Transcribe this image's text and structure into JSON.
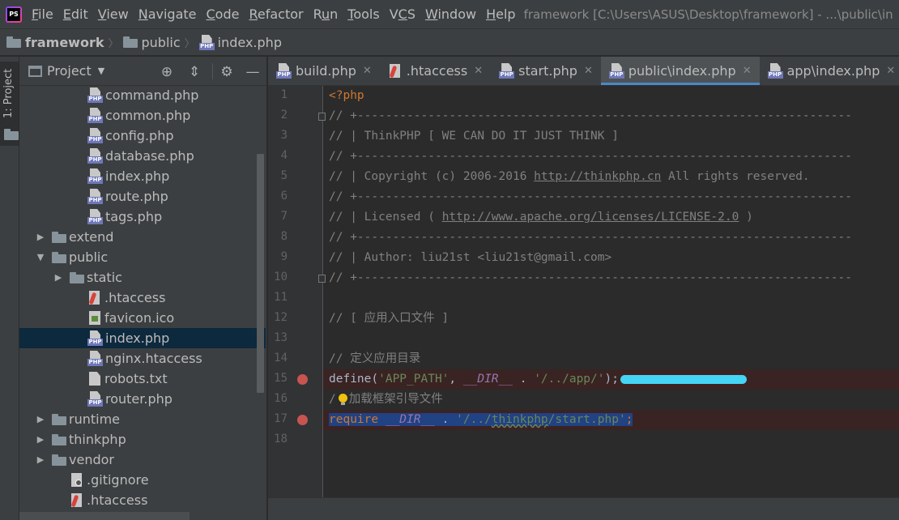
{
  "menu": {
    "items": [
      "File",
      "Edit",
      "View",
      "Navigate",
      "Code",
      "Refactor",
      "Run",
      "Tools",
      "VCS",
      "Window",
      "Help"
    ],
    "underline_index": [
      0,
      0,
      0,
      0,
      0,
      0,
      1,
      0,
      1,
      0,
      0
    ],
    "window_title": "framework [C:\\Users\\ASUS\\Desktop\\framework] - ...\\public\\in",
    "logo_text": "PS"
  },
  "breadcrumb": {
    "items": [
      "framework",
      "public",
      "index.php"
    ]
  },
  "toolstrip": {
    "project_label": "1: Project"
  },
  "project": {
    "title": "Project",
    "tree": [
      {
        "label": "command.php",
        "icon": "php-file-icon",
        "indent": 3,
        "toggle": ""
      },
      {
        "label": "common.php",
        "icon": "php-file-icon",
        "indent": 3,
        "toggle": ""
      },
      {
        "label": "config.php",
        "icon": "php-file-icon",
        "indent": 3,
        "toggle": ""
      },
      {
        "label": "database.php",
        "icon": "php-file-icon",
        "indent": 3,
        "toggle": ""
      },
      {
        "label": "index.php",
        "icon": "php-file-icon",
        "indent": 3,
        "toggle": ""
      },
      {
        "label": "route.php",
        "icon": "php-file-icon",
        "indent": 3,
        "toggle": ""
      },
      {
        "label": "tags.php",
        "icon": "php-file-icon",
        "indent": 3,
        "toggle": ""
      },
      {
        "label": "extend",
        "icon": "folder-icon",
        "indent": 1,
        "toggle": "▶"
      },
      {
        "label": "public",
        "icon": "folder-icon",
        "indent": 1,
        "toggle": "▼"
      },
      {
        "label": "static",
        "icon": "folder-icon",
        "indent": 2,
        "toggle": "▶"
      },
      {
        "label": ".htaccess",
        "icon": "htaccess-file-icon",
        "indent": 3,
        "toggle": ""
      },
      {
        "label": "favicon.ico",
        "icon": "image-file-icon",
        "indent": 3,
        "toggle": ""
      },
      {
        "label": "index.php",
        "icon": "php-file-icon",
        "indent": 3,
        "toggle": "",
        "selected": true
      },
      {
        "label": "nginx.htaccess",
        "icon": "php-file-icon",
        "indent": 3,
        "toggle": ""
      },
      {
        "label": "robots.txt",
        "icon": "text-file-icon",
        "indent": 3,
        "toggle": ""
      },
      {
        "label": "router.php",
        "icon": "php-file-icon",
        "indent": 3,
        "toggle": ""
      },
      {
        "label": "runtime",
        "icon": "folder-icon",
        "indent": 1,
        "toggle": "▶"
      },
      {
        "label": "thinkphp",
        "icon": "folder-icon",
        "indent": 1,
        "toggle": "▶"
      },
      {
        "label": "vendor",
        "icon": "folder-icon",
        "indent": 1,
        "toggle": "▶"
      },
      {
        "label": ".gitignore",
        "icon": "gitignore-file-icon",
        "indent": 2,
        "toggle": ""
      },
      {
        "label": ".htaccess",
        "icon": "htaccess-file-icon",
        "indent": 2,
        "toggle": ""
      }
    ]
  },
  "tabs": [
    {
      "label": "build.php",
      "icon": "php-file-icon",
      "active": false
    },
    {
      "label": ".htaccess",
      "icon": "htaccess-file-icon",
      "active": false
    },
    {
      "label": "start.php",
      "icon": "php-file-icon",
      "active": false
    },
    {
      "label": "public\\index.php",
      "icon": "php-file-icon",
      "active": true
    },
    {
      "label": "app\\index.php",
      "icon": "php-file-icon",
      "active": false
    },
    {
      "label": "",
      "icon": "php-file-icon",
      "active": false
    }
  ],
  "editor": {
    "line_numbers": [
      "1",
      "2",
      "3",
      "4",
      "5",
      "6",
      "7",
      "8",
      "9",
      "10",
      "11",
      "12",
      "13",
      "14",
      "15",
      "16",
      "17",
      "18"
    ],
    "breakpoints": [
      15,
      17
    ],
    "fold_markers": [
      2,
      10
    ],
    "code": {
      "l1": "<?php",
      "l2": "// +----------------------------------------------------------------------",
      "l3": "// | ThinkPHP [ WE CAN DO IT JUST THINK ]",
      "l4": "// +----------------------------------------------------------------------",
      "l5_pre": "// | Copyright (c) 2006-2016 ",
      "l5_link": "http://thinkphp.cn",
      "l5_post": " All rights reserved.",
      "l6": "// +----------------------------------------------------------------------",
      "l7_pre": "// | Licensed ( ",
      "l7_link": "http://www.apache.org/licenses/LICENSE-2.0",
      "l7_post": " )",
      "l8": "// +----------------------------------------------------------------------",
      "l9": "// | Author: liu21st <liu21st@gmail.com>",
      "l10": "// +----------------------------------------------------------------------",
      "l12": "// [ 应用入口文件 ]",
      "l14": "// 定义应用目录",
      "l15_fn": "define(",
      "l15_s1": "'APP_PATH'",
      "l15_c1": ", ",
      "l15_const": "__DIR__",
      "l15_dot": " . ",
      "l15_s2": "'/../app/'",
      "l15_end": ");",
      "l16_pre": "/",
      "l16_post": "加载框架引导文件",
      "l17_kw": "require",
      "l17_const": "__DIR__",
      "l17_dot": " . ",
      "l17_s_pre": "'/../",
      "l17_s_typo": "thinkphp",
      "l17_s_post": "/start.php'",
      "l17_end": ";"
    }
  },
  "colors": {
    "background": "#2b2b2b",
    "panel": "#3c3f41",
    "selection": "#214283",
    "breakpoint": "#c75450",
    "active_tab_underline": "#4a88c7"
  }
}
